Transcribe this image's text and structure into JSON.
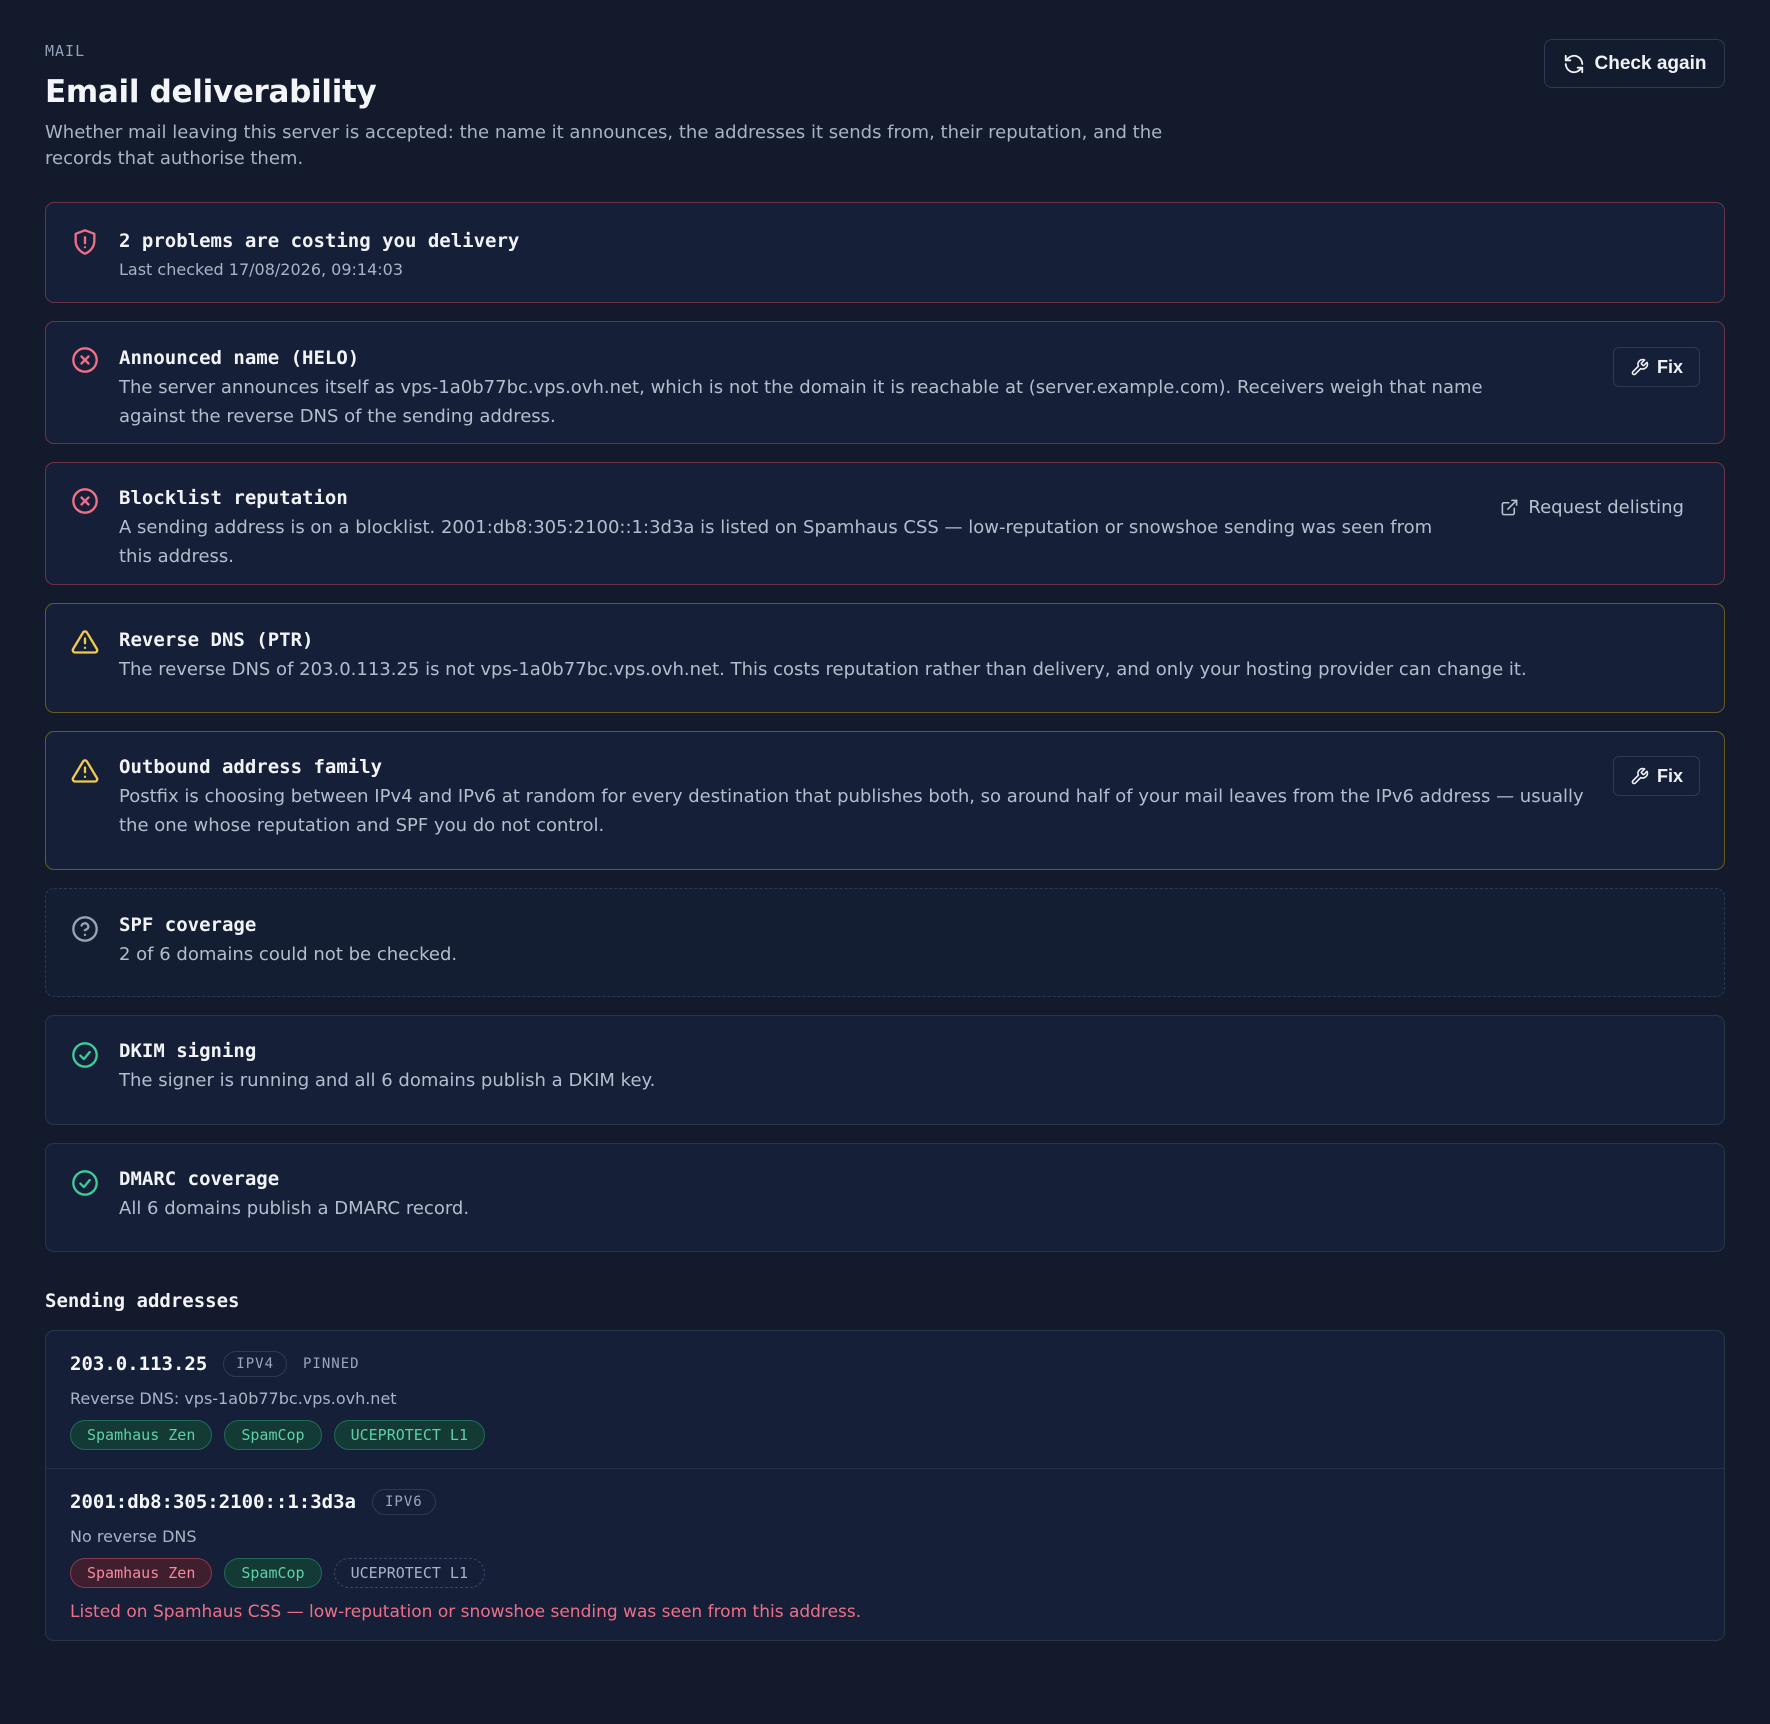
{
  "header": {
    "eyebrow": "MAIL",
    "title": "Email deliverability",
    "subtitle": "Whether mail leaving this server is accepted: the name it announces, the addresses it sends from, their reputation, and the records that authorise them.",
    "check_again_label": "Check again"
  },
  "summary": {
    "title": "2 problems are costing you delivery",
    "last_checked": "Last checked 17/08/2026, 09:14:03"
  },
  "checks": [
    {
      "title": "Announced name (HELO)",
      "desc": "The server announces itself as vps-1a0b77bc.vps.ovh.net, which is not the domain it is reachable at (server.example.com). Receivers weigh that name against the reverse DNS of the sending address.",
      "status": "error",
      "action": "Fix"
    },
    {
      "title": "Blocklist reputation",
      "desc": "A sending address is on a blocklist. 2001:db8:305:2100::1:3d3a is listed on Spamhaus CSS — low-reputation or snowshoe sending was seen from this address.",
      "status": "error",
      "action": "Request delisting"
    },
    {
      "title": "Reverse DNS (PTR)",
      "desc": "The reverse DNS of 203.0.113.25 is not vps-1a0b77bc.vps.ovh.net. This costs reputation rather than delivery, and only your hosting provider can change it.",
      "status": "warning"
    },
    {
      "title": "Outbound address family",
      "desc": "Postfix is choosing between IPv4 and IPv6 at random for every destination that publishes both, so around half of your mail leaves from the IPv6 address — usually the one whose reputation and SPF you do not control.",
      "status": "warning",
      "action": "Fix"
    },
    {
      "title": "SPF coverage",
      "desc": "2 of 6 domains could not be checked.",
      "status": "unknown"
    },
    {
      "title": "DKIM signing",
      "desc": "The signer is running and all 6 domains publish a DKIM key.",
      "status": "ok"
    },
    {
      "title": "DMARC coverage",
      "desc": "All 6 domains publish a DMARC record.",
      "status": "ok"
    }
  ],
  "sending": {
    "heading": "Sending addresses",
    "addresses": [
      {
        "ip": "203.0.113.25",
        "family": "IPV4",
        "pinned": "PINNED",
        "rdns": "Reverse DNS: vps-1a0b77bc.vps.ovh.net",
        "lists": [
          {
            "name": "Spamhaus Zen",
            "state": "clean"
          },
          {
            "name": "SpamCop",
            "state": "clean"
          },
          {
            "name": "UCEPROTECT L1",
            "state": "clean"
          }
        ]
      },
      {
        "ip": "2001:db8:305:2100::1:3d3a",
        "family": "IPV6",
        "rdns": "No reverse DNS",
        "lists": [
          {
            "name": "Spamhaus Zen",
            "state": "listed"
          },
          {
            "name": "SpamCop",
            "state": "clean"
          },
          {
            "name": "UCEPROTECT L1",
            "state": "unknown"
          }
        ],
        "note": "Listed on Spamhaus CSS — low-reputation or snowshoe sending was seen from this address."
      }
    ]
  },
  "colors": {
    "background": "#121a2c",
    "error": "#ef6f87",
    "warning": "#f2c94c",
    "ok": "#3ccb9a",
    "unknown": "#98a3b6"
  }
}
